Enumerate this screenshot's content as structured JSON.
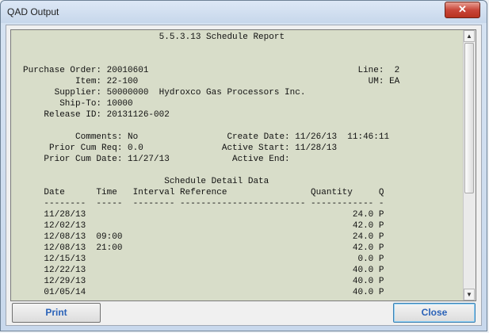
{
  "window": {
    "title": "QAD Output",
    "close_glyph": "✕"
  },
  "report": {
    "lines": [
      "                          5.5.3.13 Schedule Report",
      "",
      "",
      "Purchase Order: 20010601                                        Line:  2",
      "          Item: 22-100                                            UM: EA",
      "      Supplier: 50000000  Hydroxco Gas Processors Inc.",
      "       Ship-To: 10000",
      "    Release ID: 20131126-002",
      "",
      "          Comments: No                 Create Date: 11/26/13  11:46:11",
      "     Prior Cum Req: 0.0               Active Start: 11/28/13",
      "    Prior Cum Date: 11/27/13            Active End:",
      "",
      "                           Schedule Detail Data",
      "    Date      Time   Interval Reference                Quantity     Q",
      "    --------  -----  -------- ------------------------ ------------ -",
      "    11/28/13                                                   24.0 P",
      "    12/02/13                                                   42.0 P",
      "    12/08/13  09:00                                            24.0 P",
      "    12/08/13  21:00                                            42.0 P",
      "    12/15/13                                                    0.0 P",
      "    12/22/13                                                   40.0 P",
      "    12/29/13                                                   40.0 P",
      "    01/05/14                                                   40.0 P"
    ]
  },
  "scrollbar": {
    "up_glyph": "▲",
    "down_glyph": "▼",
    "position": 0.0
  },
  "buttons": {
    "print_label": "Print",
    "close_label": "Close"
  }
}
